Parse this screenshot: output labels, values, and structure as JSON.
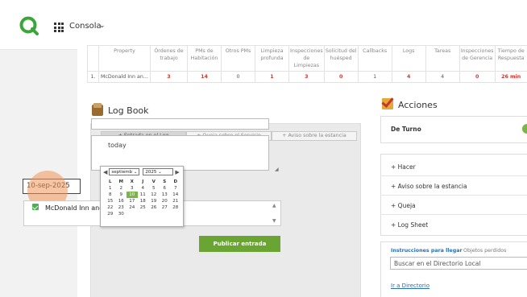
{
  "topbar": {
    "console_label": "Consola"
  },
  "table": {
    "headers": [
      "",
      "Property",
      "Órdenes de trabajo",
      "PMs de Habitación",
      "Otros PMs",
      "Limpieza profunda",
      "Inspecciones de Limpiezas",
      "Solicitud del huésped",
      "Callbacks",
      "Logs",
      "Tareas",
      "Inspecciones de Gerencia",
      "Tiempo de Respuesta"
    ],
    "row": [
      "1.",
      "McDonald Inn an...",
      "3",
      "14",
      "0",
      "1",
      "3",
      "0",
      "1",
      "4",
      "4",
      "0",
      "26 min"
    ]
  },
  "logbook": {
    "title": "Log Book",
    "tabs": [
      "+ Entrada en el Log",
      "+ Queja sobre el Servicio",
      "+ Aviso sobre la estancia"
    ],
    "textarea_value": "today",
    "date_value": "10-sep-2025",
    "property_option": "McDonald Inn and Suites",
    "publish_label": "Publicar entrada"
  },
  "calendar": {
    "month": "septiemb",
    "year": "2025",
    "weekdays": [
      "L",
      "M",
      "X",
      "J",
      "V",
      "S",
      "D"
    ],
    "days": [
      "1",
      "2",
      "3",
      "4",
      "5",
      "6",
      "7",
      "8",
      "9",
      "10",
      "11",
      "12",
      "13",
      "14",
      "15",
      "16",
      "17",
      "18",
      "19",
      "20",
      "21",
      "22",
      "23",
      "24",
      "25",
      "26",
      "27",
      "28",
      "29",
      "30"
    ],
    "selected_day": "10"
  },
  "acciones": {
    "title": "Acciones",
    "turno_label": "De Turno",
    "items": [
      "+ Hacer",
      "+ Aviso sobre la estancia",
      "+ Queja",
      "+ Log Sheet"
    ]
  },
  "directory": {
    "tab_active": "Instrucciones para llegar",
    "tab_other": "Objetos perdidos",
    "search_placeholder": "Buscar en el Directorio Local",
    "link_label": "Ir a Directorio"
  },
  "colors": {
    "accent_green": "#6aa432",
    "red_value": "#d9342b"
  }
}
